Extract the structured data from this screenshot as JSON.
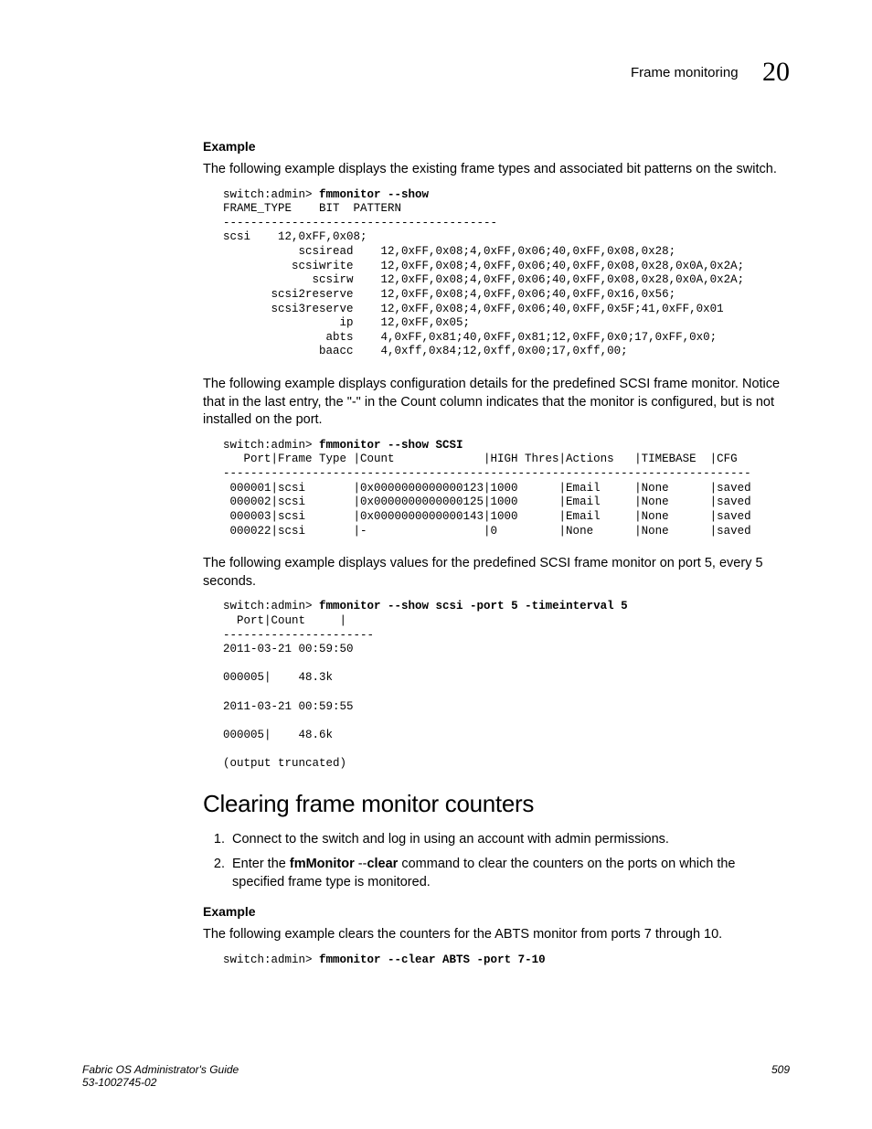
{
  "header": {
    "title": "Frame monitoring",
    "chapter": "20"
  },
  "sec1": {
    "label": "Example",
    "para1": "The following example displays the existing frame types and associated bit patterns on the switch.",
    "code1_prompt": "switch:admin> ",
    "code1_cmd": "fmmonitor --show",
    "code1_body": "FRAME_TYPE    BIT  PATTERN\n----------------------------------------\nscsi    12,0xFF,0x08;\n           scsiread    12,0xFF,0x08;4,0xFF,0x06;40,0xFF,0x08,0x28;\n          scsiwrite    12,0xFF,0x08;4,0xFF,0x06;40,0xFF,0x08,0x28,0x0A,0x2A;\n             scsirw    12,0xFF,0x08;4,0xFF,0x06;40,0xFF,0x08,0x28,0x0A,0x2A;\n       scsi2reserve    12,0xFF,0x08;4,0xFF,0x06;40,0xFF,0x16,0x56;\n       scsi3reserve    12,0xFF,0x08;4,0xFF,0x06;40,0xFF,0x5F;41,0xFF,0x01\n                 ip    12,0xFF,0x05;\n               abts    4,0xFF,0x81;40,0xFF,0x81;12,0xFF,0x0;17,0xFF,0x0;\n              baacc    4,0xff,0x84;12,0xff,0x00;17,0xff,00;",
    "para2": "The following example displays configuration details for the predefined SCSI frame monitor. Notice that in the last entry, the \"-\" in the Count column indicates that the monitor is configured, but is not installed on the port.",
    "code2_prompt": "switch:admin> ",
    "code2_cmd": "fmmonitor --show SCSI",
    "code2_body": "\n   Port|Frame Type |Count             |HIGH Thres|Actions   |TIMEBASE  |CFG\n-----------------------------------------------------------------------------\n 000001|scsi       |0x0000000000000123|1000      |Email     |None      |saved\n 000002|scsi       |0x0000000000000125|1000      |Email     |None      |saved\n 000003|scsi       |0x0000000000000143|1000      |Email     |None      |saved\n 000022|scsi       |-                 |0         |None      |None      |saved",
    "para3": "The following example displays values for the predefined SCSI frame monitor on port 5, every 5 seconds.",
    "code3_prompt": "switch:admin> ",
    "code3_cmd": "fmmonitor --show scsi -port 5 -timeinterval 5",
    "code3_body": "  Port|Count     |\n----------------------\n2011-03-21 00:59:50\n\n000005|    48.3k\n\n2011-03-21 00:59:55\n\n000005|    48.6k\n\n(output truncated)"
  },
  "sec2": {
    "heading": "Clearing frame monitor counters",
    "step1": "Connect to the switch and log in using an account with admin permissions.",
    "step2a": "Enter the ",
    "step2b": "fmMonitor ",
    "step2c": " --",
    "step2d": "clear",
    "step2e": " command to clear the counters on the ports on which the specified frame type is monitored.",
    "label": "Example",
    "para": "The following example clears the counters for the ABTS monitor from ports 7 through 10.",
    "code_prompt": "switch:admin> ",
    "code_cmd": "fmmonitor --clear ABTS -port 7-10"
  },
  "footer": {
    "guide": "Fabric OS Administrator's Guide",
    "doc": "53-1002745-02",
    "page": "509"
  }
}
